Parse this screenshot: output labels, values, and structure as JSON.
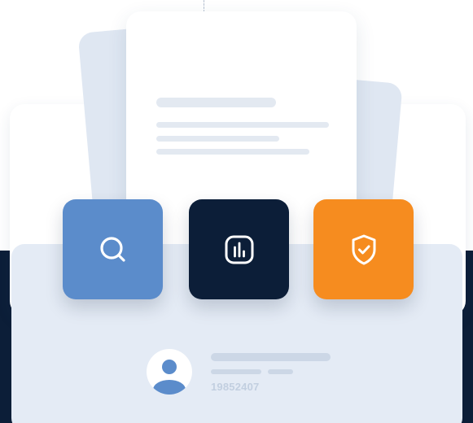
{
  "tiles": [
    {
      "icon": "search-icon",
      "color": "#5b8ccb"
    },
    {
      "icon": "bar-chart-icon",
      "color": "#0c1e38"
    },
    {
      "icon": "shield-check-icon",
      "color": "#f68c1f"
    }
  ],
  "profile": {
    "id_number": "19852407"
  },
  "colors": {
    "navy": "#0c1e38",
    "panel": "#e4ebf5",
    "accent_blue": "#5b8ccb",
    "accent_orange": "#f68c1f"
  }
}
